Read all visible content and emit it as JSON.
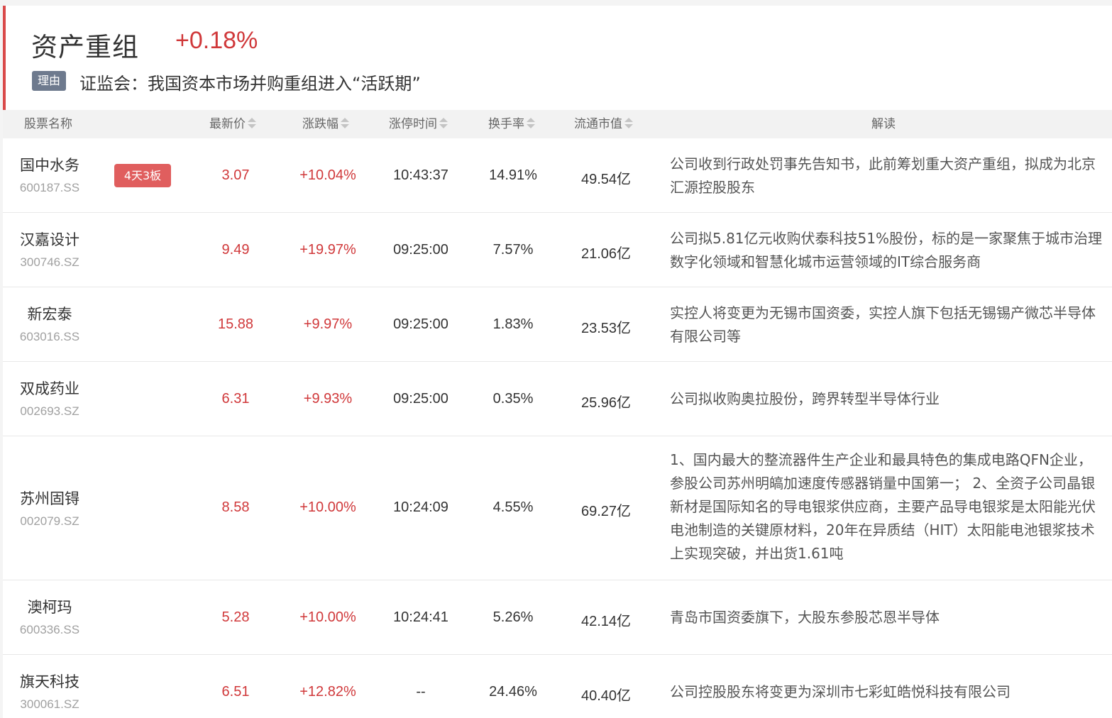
{
  "header": {
    "title": "资产重组",
    "change": "+0.18%",
    "reason_tag": "理由",
    "reason_text": "证监会：我国资本市场并购重组进入“活跃期”"
  },
  "columns": {
    "name": "股票名称",
    "price": "最新价",
    "pct": "涨跌幅",
    "time": "涨停时间",
    "turnover": "换手率",
    "cap": "流通市值",
    "desc": "解读"
  },
  "colors": {
    "accent": "#d94a4a",
    "up": "#d0383a",
    "tag": "#6e7a8e",
    "badge": "#e05e5e"
  },
  "rows": [
    {
      "name": "国中水务",
      "code": "600187.SS",
      "badge": "4天3板",
      "price": "3.07",
      "pct": "+10.04%",
      "time": "10:43:37",
      "turnover": "14.91%",
      "cap": "49.54亿",
      "desc": "公司收到行政处罚事先告知书，此前筹划重大资产重组，拟成为北京汇源控股股东"
    },
    {
      "name": "汉嘉设计",
      "code": "300746.SZ",
      "badge": "",
      "price": "9.49",
      "pct": "+19.97%",
      "time": "09:25:00",
      "turnover": "7.57%",
      "cap": "21.06亿",
      "desc": "公司拟5.81亿元收购伏泰科技51%股份，标的是一家聚焦于城市治理数字化领域和智慧化城市运营领域的IT综合服务商"
    },
    {
      "name": "新宏泰",
      "code": "603016.SS",
      "badge": "",
      "price": "15.88",
      "pct": "+9.97%",
      "time": "09:25:00",
      "turnover": "1.83%",
      "cap": "23.53亿",
      "desc": "实控人将变更为无锡市国资委，实控人旗下包括无锡锡产微芯半导体有限公司等"
    },
    {
      "name": "双成药业",
      "code": "002693.SZ",
      "badge": "",
      "price": "6.31",
      "pct": "+9.93%",
      "time": "09:25:00",
      "turnover": "0.35%",
      "cap": "25.96亿",
      "desc": "公司拟收购奥拉股份，跨界转型半导体行业"
    },
    {
      "name": "苏州固锝",
      "code": "002079.SZ",
      "badge": "",
      "price": "8.58",
      "pct": "+10.00%",
      "time": "10:24:09",
      "turnover": "4.55%",
      "cap": "69.27亿",
      "desc": "1、国内最大的整流器件生产企业和最具特色的集成电路QFN企业，参股公司苏州明皜加速度传感器销量中国第一； 2、全资子公司晶银新材是国际知名的导电银浆供应商，主要产品导电银浆是太阳能光伏电池制造的关键原材料，20年在异质结（HIT）太阳能电池银浆技术上实现突破，并出货1.61吨"
    },
    {
      "name": "澳柯玛",
      "code": "600336.SS",
      "badge": "",
      "price": "5.28",
      "pct": "+10.00%",
      "time": "10:24:41",
      "turnover": "5.26%",
      "cap": "42.14亿",
      "desc": "青岛市国资委旗下，大股东参股芯恩半导体"
    },
    {
      "name": "旗天科技",
      "code": "300061.SZ",
      "badge": "",
      "price": "6.51",
      "pct": "+12.82%",
      "time": "--",
      "turnover": "24.46%",
      "cap": "40.40亿",
      "desc": "公司控股股东将变更为深圳市七彩虹皓悦科技有限公司"
    }
  ]
}
